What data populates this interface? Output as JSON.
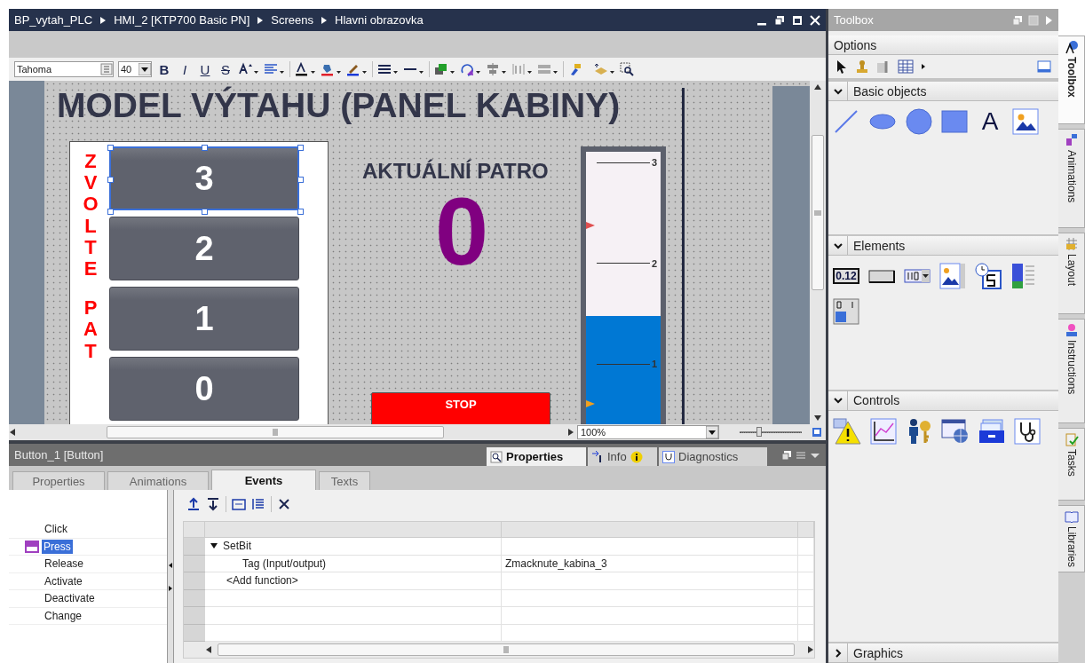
{
  "editor": {
    "breadcrumb": [
      "BP_vytah_PLC",
      "HMI_2 [KTP700 Basic PN]",
      "Screens",
      "Hlavni obrazovka"
    ],
    "font_field": {
      "value": "Tahoma"
    },
    "size_field": {
      "value": "40"
    },
    "format_glyphs": [
      {
        "kind": "bold",
        "text": "B"
      },
      {
        "kind": "italic",
        "text": "I"
      },
      {
        "kind": "underline",
        "text": "U"
      },
      {
        "kind": "strike",
        "text": "S"
      }
    ],
    "screen": {
      "title": "MODEL VÝTAHU (PANEL KABINY)",
      "side_label": [
        "ZVOLTE",
        "PAT"
      ],
      "floor_buttons": [
        {
          "label": "3",
          "selected": true
        },
        {
          "label": "2",
          "selected": false
        },
        {
          "label": "1",
          "selected": false
        },
        {
          "label": "0",
          "selected": false
        }
      ],
      "current_floor": {
        "caption": "AKTUÁLNÍ PATRO",
        "value": "0"
      },
      "gauge": {
        "ticks": [
          "3",
          "2",
          "1"
        ],
        "level": 0.43
      },
      "stop_button": {
        "label": "STOP"
      }
    },
    "zoom": {
      "value": "100%"
    }
  },
  "inspector": {
    "object": "Button_1 [Button]",
    "tabs": [
      {
        "label": "Properties",
        "selected": true
      },
      {
        "label": "Info",
        "selected": false
      },
      {
        "label": "Diagnostics",
        "selected": false
      }
    ],
    "subtabs": [
      {
        "label": "Properties",
        "selected": false
      },
      {
        "label": "Animations",
        "selected": false
      },
      {
        "label": "Events",
        "selected": true
      },
      {
        "label": "Texts",
        "selected": false
      }
    ],
    "events": [
      {
        "label": "Click",
        "selected": false
      },
      {
        "label": "Press",
        "selected": true
      },
      {
        "label": "Release",
        "selected": false
      },
      {
        "label": "Activate",
        "selected": false
      },
      {
        "label": "Deactivate",
        "selected": false
      },
      {
        "label": "Change",
        "selected": false
      }
    ],
    "table": {
      "rows": [
        {
          "kind": "function",
          "name": "SetBit",
          "expanded": true
        },
        {
          "kind": "param",
          "name": "Tag (Input/output)",
          "value": "Zmacknute_kabina_3"
        },
        {
          "kind": "add",
          "name": "<Add function>"
        }
      ]
    }
  },
  "toolbox": {
    "title": "Toolbox",
    "options": "Options",
    "sections": [
      {
        "title": "Basic objects",
        "expanded": true,
        "tools": [
          {
            "kind": "line"
          },
          {
            "kind": "ellipse"
          },
          {
            "kind": "circle"
          },
          {
            "kind": "rectangle"
          },
          {
            "kind": "text",
            "glyph": "A"
          },
          {
            "kind": "graphic"
          }
        ]
      },
      {
        "title": "Elements",
        "expanded": true,
        "tools": [
          {
            "kind": "io_field",
            "glyph": "0.12"
          },
          {
            "kind": "button"
          },
          {
            "kind": "symbolic_io"
          },
          {
            "kind": "graphic_io"
          },
          {
            "kind": "date_time"
          },
          {
            "kind": "bar"
          },
          {
            "kind": "switch"
          }
        ]
      },
      {
        "title": "Controls",
        "expanded": true,
        "tools": [
          {
            "kind": "alarm_view"
          },
          {
            "kind": "trend_view"
          },
          {
            "kind": "user_view"
          },
          {
            "kind": "browser"
          },
          {
            "kind": "recipe_view"
          },
          {
            "kind": "diagnostics"
          }
        ]
      },
      {
        "title": "Graphics",
        "expanded": false
      }
    ]
  },
  "side_tabs": [
    {
      "label": "Toolbox",
      "selected": true
    },
    {
      "label": "Animations",
      "selected": false
    },
    {
      "label": "Layout",
      "selected": false
    },
    {
      "label": "Instructions",
      "selected": false
    },
    {
      "label": "Tasks",
      "selected": false
    },
    {
      "label": "Libraries",
      "selected": false
    }
  ]
}
